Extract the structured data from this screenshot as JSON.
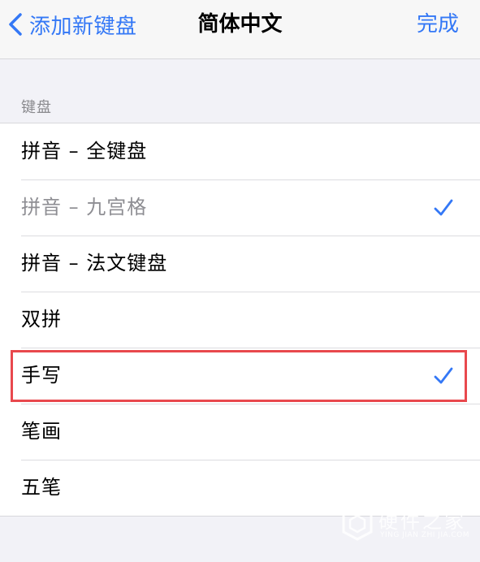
{
  "nav": {
    "back_label": "添加新键盘",
    "title": "简体中文",
    "done_label": "完成"
  },
  "section": {
    "header": "键盘"
  },
  "keyboards": [
    {
      "label": "拼音 – 全键盘",
      "checked": false,
      "disabled": false
    },
    {
      "label": "拼音 – 九宫格",
      "checked": true,
      "disabled": true
    },
    {
      "label": "拼音 – 法文键盘",
      "checked": false,
      "disabled": false
    },
    {
      "label": "双拼",
      "checked": false,
      "disabled": false
    },
    {
      "label": "手写",
      "checked": true,
      "disabled": false,
      "highlighted": true
    },
    {
      "label": "笔画",
      "checked": false,
      "disabled": false
    },
    {
      "label": "五笔",
      "checked": false,
      "disabled": false
    }
  ],
  "watermark": {
    "text": "硬件之家",
    "subtext": "YING JIAN ZHI JIA.COM"
  },
  "colors": {
    "accent": "#3478f6",
    "highlight": "#e8484d",
    "background": "#f2f2f7"
  }
}
